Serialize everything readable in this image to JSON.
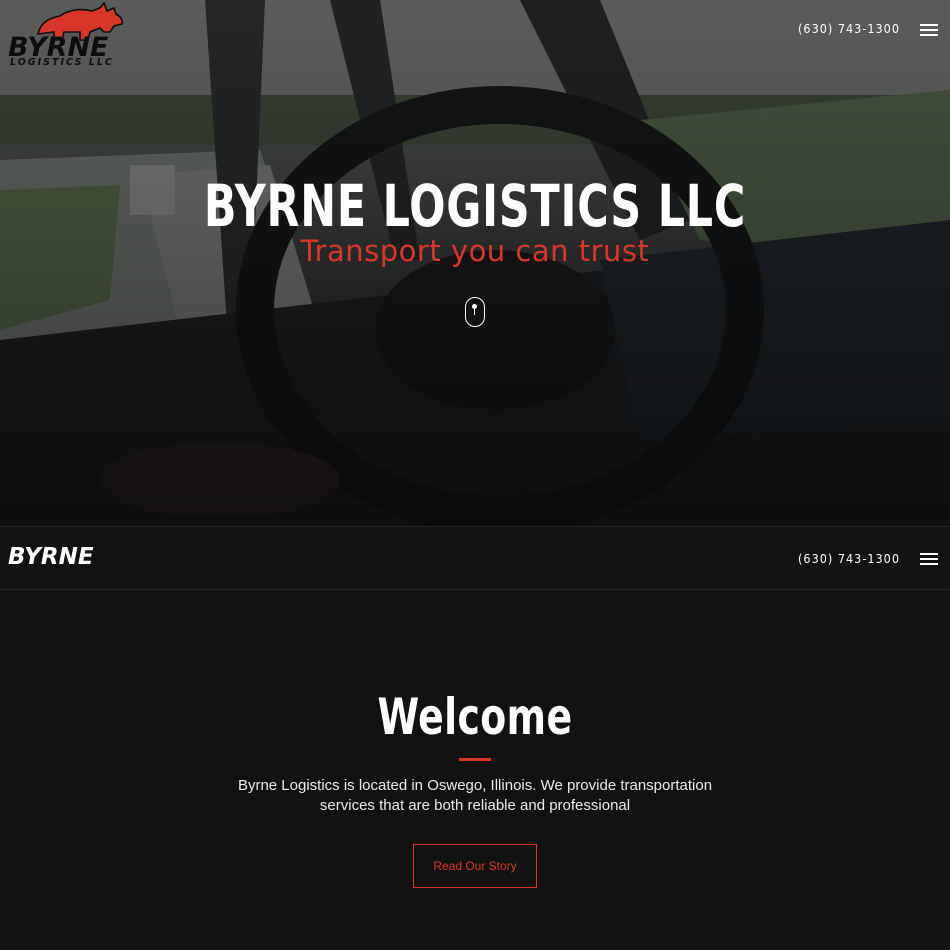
{
  "brand": {
    "logo_word": "BYRNE",
    "logo_sub": "LOGISTICS LLC",
    "accent_color": "#d9362a",
    "background_color": "#121212"
  },
  "hero": {
    "phone": "(630) 743-1300",
    "title": "BYRNE LOGISTICS LLC",
    "tagline": "Transport you can trust",
    "menu_icon": "hamburger-menu-icon",
    "scroll_icon": "scroll-mouse-icon"
  },
  "navbar": {
    "logo_text": "BYRNE",
    "phone": "(630) 743-1300",
    "menu_icon": "hamburger-menu-icon"
  },
  "welcome": {
    "title": "Welcome",
    "body": "Byrne Logistics is located in Oswego, Illinois. We provide transportation services that are both reliable and professional",
    "button_label": "Read Our Story"
  }
}
